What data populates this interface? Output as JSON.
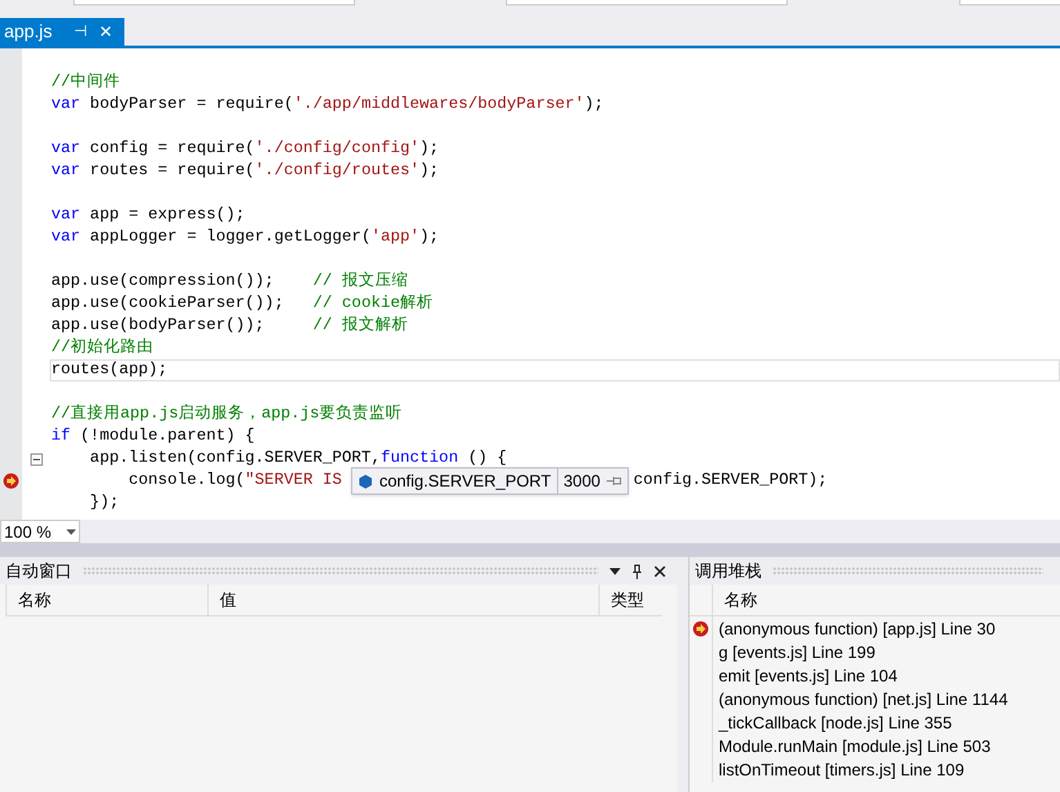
{
  "tab": {
    "label": "app.js",
    "selected": true,
    "pin": "⊣",
    "close": "✕"
  },
  "editor": {
    "lines": [
      {
        "tokens": [
          {
            "kind": "comment",
            "text": "//中间件"
          }
        ]
      },
      {
        "tokens": [
          {
            "kind": "keyword",
            "text": "var"
          },
          {
            "kind": "plain",
            "text": " bodyParser = require("
          },
          {
            "kind": "string",
            "text": "'./app/middlewares/bodyParser'"
          },
          {
            "kind": "plain",
            "text": ");"
          }
        ]
      },
      {
        "blank_before": true,
        "tokens": [
          {
            "kind": "keyword",
            "text": "var"
          },
          {
            "kind": "plain",
            "text": " config = require("
          },
          {
            "kind": "string",
            "text": "'./config/config'"
          },
          {
            "kind": "plain",
            "text": ");"
          }
        ]
      },
      {
        "tokens": [
          {
            "kind": "keyword",
            "text": "var"
          },
          {
            "kind": "plain",
            "text": " routes = require("
          },
          {
            "kind": "string",
            "text": "'./config/routes'"
          },
          {
            "kind": "plain",
            "text": ");"
          }
        ]
      },
      {
        "blank_before": true,
        "tokens": [
          {
            "kind": "keyword",
            "text": "var"
          },
          {
            "kind": "plain",
            "text": " app = express();"
          }
        ]
      },
      {
        "tokens": [
          {
            "kind": "keyword",
            "text": "var"
          },
          {
            "kind": "plain",
            "text": " appLogger = logger.getLogger("
          },
          {
            "kind": "string",
            "text": "'app'"
          },
          {
            "kind": "plain",
            "text": ");"
          }
        ]
      },
      {
        "blank_before": true,
        "tokens": [
          {
            "kind": "plain",
            "text": "app.use(compression());    "
          },
          {
            "kind": "comment",
            "text": "// 报文压缩"
          }
        ]
      },
      {
        "tokens": [
          {
            "kind": "plain",
            "text": "app.use(cookieParser());   "
          },
          {
            "kind": "comment",
            "text": "// cookie解析"
          }
        ]
      },
      {
        "tokens": [
          {
            "kind": "plain",
            "text": "app.use(bodyParser());     "
          },
          {
            "kind": "comment",
            "text": "// 报文解析"
          }
        ]
      },
      {
        "tokens": [
          {
            "kind": "comment",
            "text": "//初始化路由"
          }
        ]
      },
      {
        "current": true,
        "tokens": [
          {
            "kind": "plain",
            "text": "routes(app);"
          }
        ]
      },
      {
        "blank_before": true,
        "tokens": [
          {
            "kind": "comment",
            "text": "//直接用app.js启动服务，app.js要负责监听"
          }
        ]
      },
      {
        "tokens": [
          {
            "kind": "keyword",
            "text": "if"
          },
          {
            "kind": "plain",
            "text": " (!module.parent) {"
          }
        ]
      },
      {
        "collapsible": true,
        "tokens": [
          {
            "kind": "plain",
            "text": "    app.listen(config.SERVER_PORT,"
          },
          {
            "kind": "keyword",
            "text": "function"
          },
          {
            "kind": "plain",
            "text": " () {"
          }
        ]
      },
      {
        "breakpoint": true,
        "tokens": [
          {
            "kind": "plain",
            "text": "        console.log("
          },
          {
            "kind": "string",
            "text": "\"SERVER IS "
          },
          {
            "kind": "tooltip",
            "name": "config.SERVER_PORT",
            "value": "3000"
          },
          {
            "kind": "plain",
            "text": "config.SERVER_PORT);"
          }
        ]
      },
      {
        "tokens": [
          {
            "kind": "plain",
            "text": "    });"
          }
        ]
      }
    ]
  },
  "zoom": "100 %",
  "autos": {
    "title": "自动窗口",
    "columns": [
      "名称",
      "值",
      "类型"
    ]
  },
  "callstack": {
    "title": "调用堆栈",
    "column": "名称",
    "frames": [
      {
        "text": "(anonymous function) [app.js] Line 30",
        "current": true
      },
      {
        "text": "g [events.js] Line 199",
        "current": false
      },
      {
        "text": "emit [events.js] Line 104",
        "current": false
      },
      {
        "text": "(anonymous function) [net.js] Line 1144",
        "current": false
      },
      {
        "text": "_tickCallback [node.js] Line 355",
        "current": false
      },
      {
        "text": "Module.runMain [module.js] Line 503",
        "current": false
      },
      {
        "text": "listOnTimeout [timers.js] Line 109",
        "current": false
      }
    ]
  }
}
